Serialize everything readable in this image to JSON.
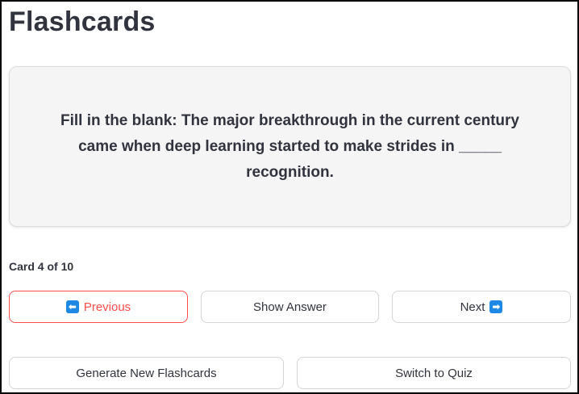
{
  "page": {
    "title": "Flashcards"
  },
  "flashcard": {
    "question": "Fill in the blank: The major breakthrough in the current century came when deep learning started to make strides in _____ recognition."
  },
  "progress": {
    "label": "Card 4 of 10",
    "current": 4,
    "total": 10
  },
  "navigation": {
    "previous_label": "Previous",
    "show_answer_label": "Show Answer",
    "next_label": "Next"
  },
  "actions": {
    "generate_label": "Generate New Flashcards",
    "switch_label": "Switch to Quiz"
  },
  "icons": {
    "previous": "left-arrow-icon",
    "next": "right-arrow-icon"
  },
  "colors": {
    "accent_red": "#ff4b4b",
    "arrow_blue": "#1e88e5",
    "text": "#31333f",
    "card_bg": "#f5f5f5"
  }
}
